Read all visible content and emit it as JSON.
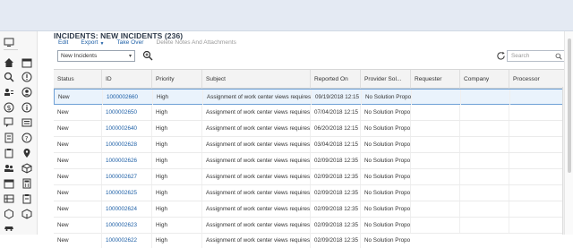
{
  "header": {
    "title": "INCIDENTS: NEW INCIDENTS (236)"
  },
  "actions": {
    "edit": "Edit",
    "export": "Export",
    "take_over": "Take Over",
    "delete_notes": "Delete Notes And Attachments"
  },
  "toolbar": {
    "query_select_value": "New Incidents",
    "search_placeholder": "Search"
  },
  "table": {
    "columns": [
      "Status",
      "ID",
      "Priority",
      "Subject",
      "Reported On",
      "Provider Sol...",
      "Requester",
      "Company",
      "Processor"
    ],
    "rows": [
      {
        "status": "New",
        "id": "1000002660",
        "priority": "High",
        "subject": "Assignment of work center views requires a",
        "reported_on": "09/19/2018 12:15",
        "provider": "No Solution Propo",
        "selected": true
      },
      {
        "status": "New",
        "id": "1000002650",
        "priority": "High",
        "subject": "Assignment of work center views requires a",
        "reported_on": "07/04/2018 12:15",
        "provider": "No Solution Propo",
        "selected": false
      },
      {
        "status": "New",
        "id": "1000002640",
        "priority": "High",
        "subject": "Assignment of work center views requires a",
        "reported_on": "06/20/2018 12:15",
        "provider": "No Solution Propo",
        "selected": false
      },
      {
        "status": "New",
        "id": "1000002628",
        "priority": "High",
        "subject": "Assignment of work center views requires a",
        "reported_on": "03/04/2018 12:15",
        "provider": "No Solution Propo",
        "selected": false
      },
      {
        "status": "New",
        "id": "1000002626",
        "priority": "High",
        "subject": "Assignment of work center views requires a",
        "reported_on": "02/09/2018 12:35",
        "provider": "No Solution Propo",
        "selected": false
      },
      {
        "status": "New",
        "id": "1000002627",
        "priority": "High",
        "subject": "Assignment of work center views requires a",
        "reported_on": "02/09/2018 12:35",
        "provider": "No Solution Propo",
        "selected": false
      },
      {
        "status": "New",
        "id": "1000002625",
        "priority": "High",
        "subject": "Assignment of work center views requires a",
        "reported_on": "02/09/2018 12:35",
        "provider": "No Solution Propo",
        "selected": false
      },
      {
        "status": "New",
        "id": "1000002624",
        "priority": "High",
        "subject": "Assignment of work center views requires a",
        "reported_on": "02/09/2018 12:35",
        "provider": "No Solution Propo",
        "selected": false
      },
      {
        "status": "New",
        "id": "1000002623",
        "priority": "High",
        "subject": "Assignment of work center views requires a",
        "reported_on": "02/09/2018 12:35",
        "provider": "No Solution Propo",
        "selected": false
      },
      {
        "status": "New",
        "id": "1000002622",
        "priority": "High",
        "subject": "Assignment of work center views requires a",
        "reported_on": "02/09/2018 12:35",
        "provider": "No Solution Propo",
        "selected": false
      }
    ]
  },
  "sidebar": {
    "icons": [
      "monitor-icon",
      "home-icon",
      "calendar-icon",
      "search-icon",
      "alert-icon",
      "people-icon",
      "person-icon",
      "money-icon",
      "info-icon",
      "chat-icon",
      "list-icon",
      "document-icon",
      "question-icon",
      "clipboard-icon",
      "map-icon",
      "users-icon",
      "box-icon",
      "calendar2-icon",
      "calculator-icon",
      "table-icon",
      "clipboard2-icon",
      "hexagon-icon",
      "cube-icon",
      "car-icon"
    ]
  },
  "colors": {
    "link": "#1d5fa6",
    "selected_row_bg": "#eaf3fc",
    "selected_row_border": "#6ea0d6",
    "header_band": "#e4eaf3"
  }
}
